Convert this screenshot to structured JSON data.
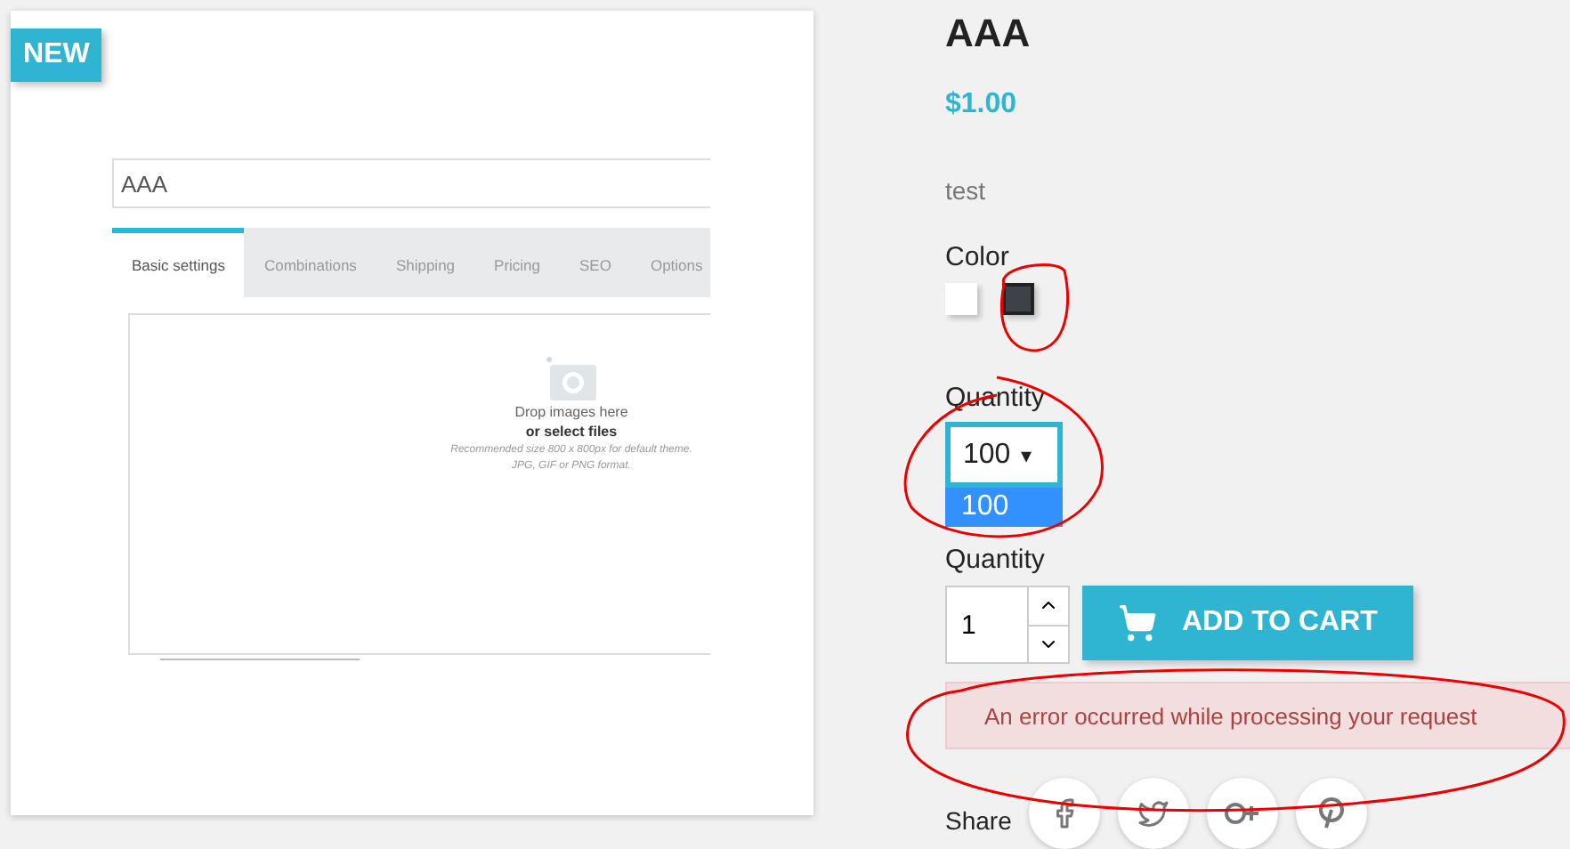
{
  "product_image": {
    "badge": "NEW",
    "name_field": {
      "value": "AAA"
    },
    "tabs": [
      {
        "label": "Basic settings",
        "selected": true
      },
      {
        "label": "Combinations",
        "selected": false
      },
      {
        "label": "Shipping",
        "selected": false
      },
      {
        "label": "Pricing",
        "selected": false
      },
      {
        "label": "SEO",
        "selected": false
      },
      {
        "label": "Options",
        "selected": false
      }
    ],
    "dropzone": {
      "title": "Drop images here",
      "link": "or select files",
      "hint": "Recommended size 800 x 800px for default theme.",
      "formats": "JPG, GIF or PNG format."
    }
  },
  "product": {
    "title": "AAA",
    "price": "$1.00",
    "description": "test",
    "color_label": "Color",
    "swatches": [
      {
        "color": "#ffffff",
        "selected": false
      },
      {
        "color": "#3d4148",
        "selected": true
      }
    ],
    "quantity_select": {
      "label": "Quantity",
      "value": "100",
      "caret": "▾",
      "options": [
        {
          "label": "100",
          "selected": true
        }
      ]
    },
    "quantity_label": "Quantity",
    "quantity_value": "1",
    "add_to_cart": "ADD TO CART",
    "error": "An error occurred while processing your request",
    "share_label": "Share",
    "social": [
      {
        "kind": "facebook"
      },
      {
        "kind": "twitter"
      },
      {
        "kind": "googleplus"
      },
      {
        "kind": "pinterest"
      }
    ]
  }
}
